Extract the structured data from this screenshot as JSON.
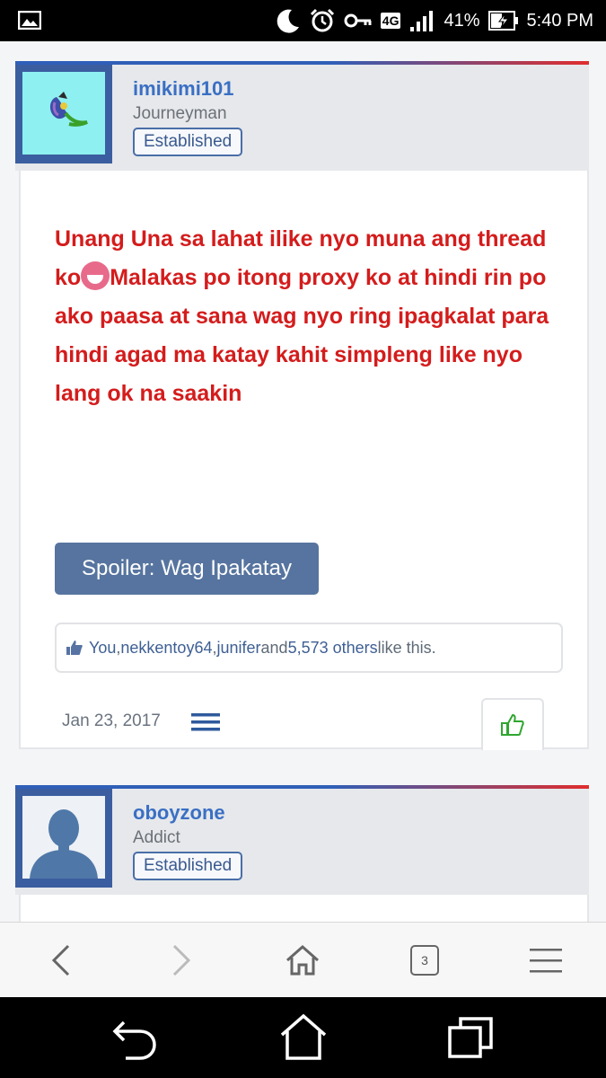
{
  "status_bar": {
    "network": "4G",
    "battery": "41%",
    "time": "5:40 PM"
  },
  "posts": [
    {
      "username": "imikimi101",
      "user_title": "Journeyman",
      "badge": "Established",
      "message": "Unang Una sa lahat ilike nyo muna ang thread ko",
      "message_after_emoji": "Malakas po itong proxy ko at hindi rin po ako paasa at sana wag nyo ring ipagkalat para hindi agad ma katay kahit simpleng like nyo lang ok na saakin",
      "spoiler_label": "Spoiler: Wag Ipakatay",
      "likes": {
        "you": "You",
        "sep1": ", ",
        "user1": "nekkentoy64",
        "sep2": ", ",
        "user2": "junifer",
        "and": " and ",
        "others": "5,573 others",
        "suffix": " like this."
      },
      "date": "Jan 23, 2017"
    },
    {
      "username": "oboyzone",
      "user_title": "Addict",
      "badge": "Established"
    }
  ],
  "browser_bar": {
    "tab_count": "3"
  },
  "colors": {
    "accent_blue": "#3a6fc4",
    "message_red": "#d41c1c",
    "button_blue": "#56749f",
    "like_green": "#2fa62f"
  },
  "icons": [
    "image-icon",
    "moon-icon",
    "alarm-icon",
    "key-icon",
    "signal-icon",
    "battery-icon",
    "thumbs-up-icon",
    "menu-icon",
    "back-icon",
    "forward-icon",
    "home-icon",
    "tabs-icon",
    "hamburger-icon",
    "nav-back-icon",
    "nav-home-icon",
    "nav-recents-icon"
  ]
}
